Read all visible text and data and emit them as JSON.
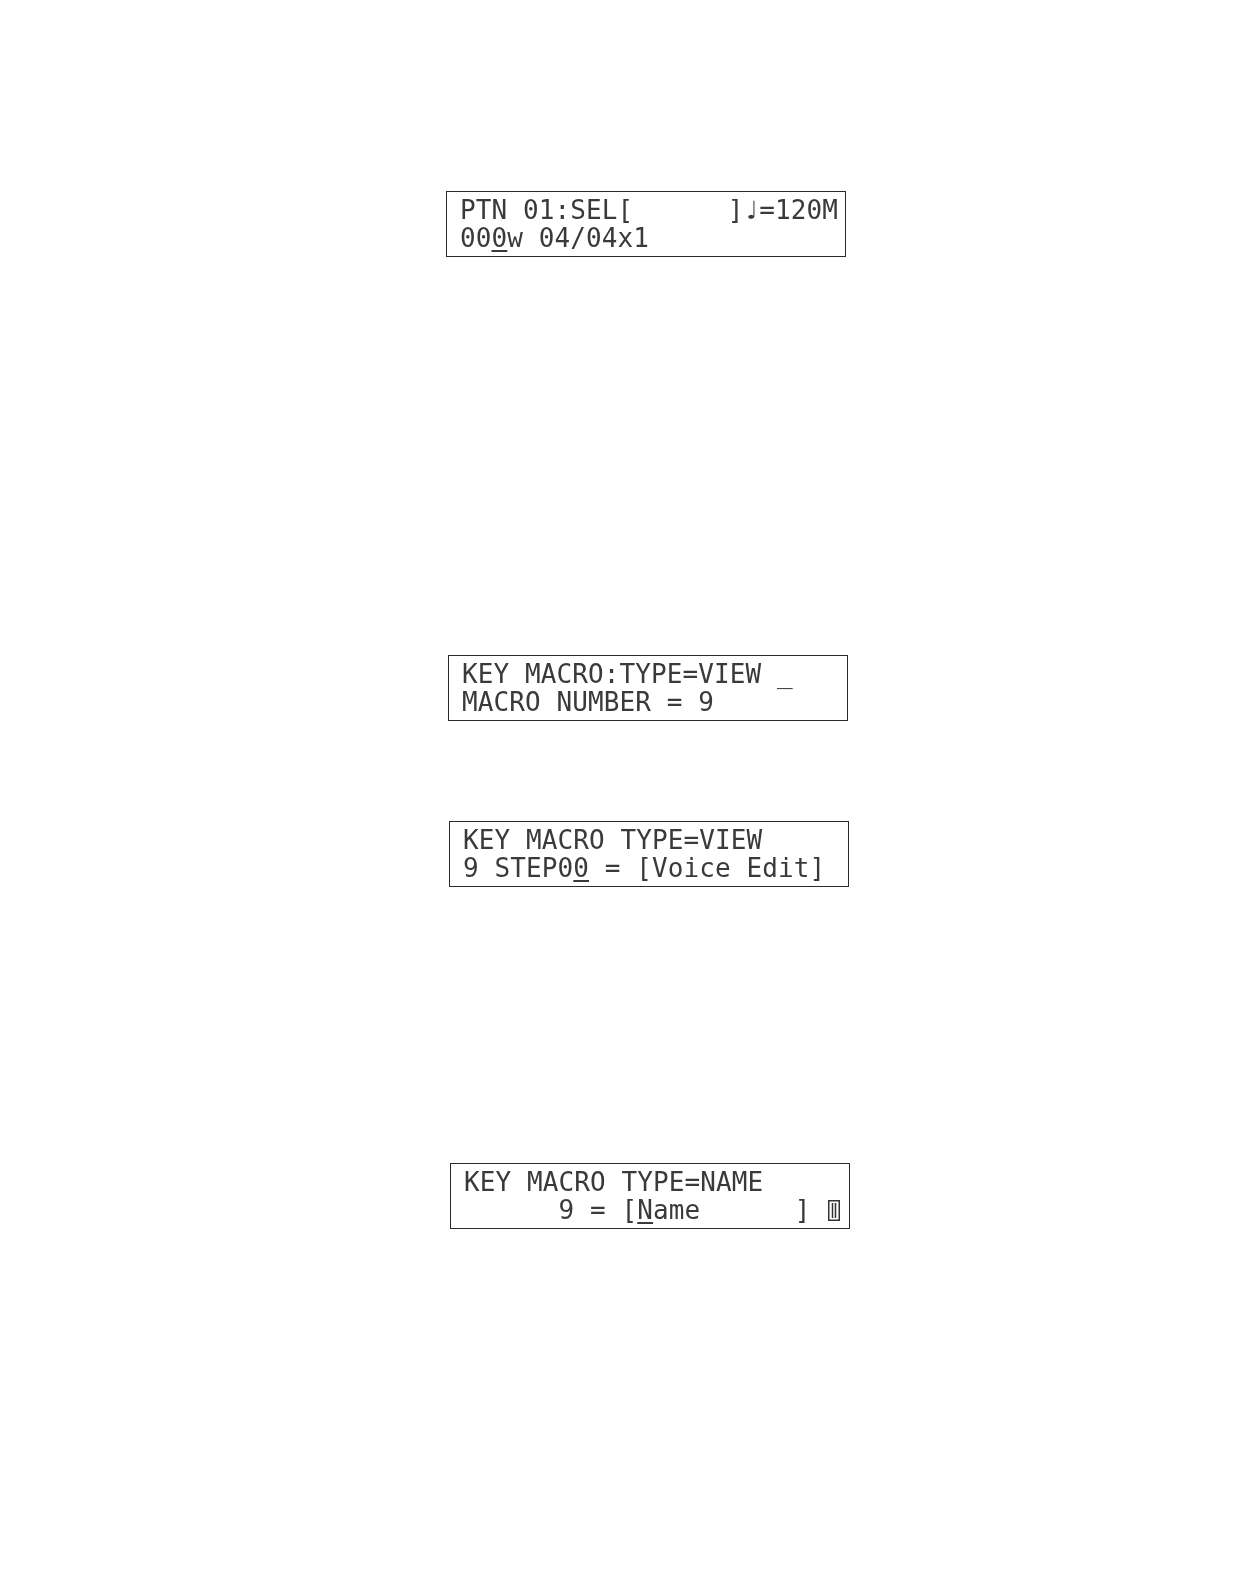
{
  "displays": [
    {
      "lines": [
        {
          "segments": [
            {
              "kind": "text",
              "text": "PTN 01:SEL[      ]♩=120M",
              "cursor": false
            }
          ]
        },
        {
          "segments": [
            {
              "kind": "text",
              "text": "00",
              "cursor": false
            },
            {
              "kind": "text",
              "text": "0",
              "cursor": true
            },
            {
              "kind": "text",
              "text": "w 04/04x1",
              "cursor": false
            }
          ]
        }
      ]
    },
    {
      "lines": [
        {
          "segments": [
            {
              "kind": "text",
              "text": "KEY MACRO:TYPE=VIEW _",
              "cursor": false
            }
          ]
        },
        {
          "segments": [
            {
              "kind": "text",
              "text": "MACRO NUMBER = 9",
              "cursor": false
            }
          ]
        }
      ]
    },
    {
      "lines": [
        {
          "segments": [
            {
              "kind": "text",
              "text": "KEY MACRO TYPE=VIEW",
              "cursor": false
            }
          ]
        },
        {
          "segments": [
            {
              "kind": "text",
              "text": "9 STEP0",
              "cursor": false
            },
            {
              "kind": "text",
              "text": "0",
              "cursor": true
            },
            {
              "kind": "text",
              "text": " = [Voice Edit]",
              "cursor": false
            }
          ]
        }
      ]
    },
    {
      "lines": [
        {
          "segments": [
            {
              "kind": "text",
              "text": "KEY MACRO TYPE=NAME",
              "cursor": false
            }
          ]
        },
        {
          "segments": [
            {
              "kind": "text",
              "text": "      9 = [",
              "cursor": false
            },
            {
              "kind": "text",
              "text": "N",
              "cursor": true
            },
            {
              "kind": "text",
              "text": "ame      ]",
              "cursor": false
            },
            {
              "kind": "glyph"
            }
          ]
        }
      ]
    }
  ]
}
